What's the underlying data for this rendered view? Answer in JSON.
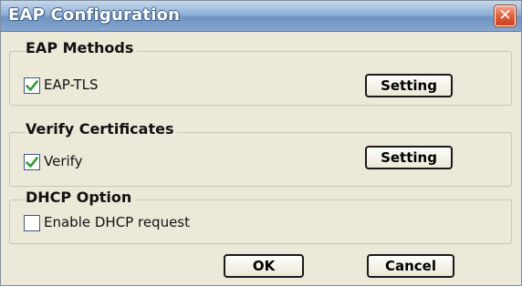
{
  "window": {
    "title": "EAP Configuration",
    "close_glyph": "✕"
  },
  "eap_methods": {
    "title": "EAP Methods",
    "checkbox_label": "EAP-TLS",
    "checked": true,
    "setting_label": "Setting"
  },
  "verify_certificates": {
    "title": "Verify Certificates",
    "checkbox_label": "Verify",
    "checked": true,
    "setting_label": "Setting"
  },
  "dhcp_option": {
    "title": "DHCP Option",
    "checkbox_label": "Enable DHCP request",
    "checked": false
  },
  "footer": {
    "ok_label": "OK",
    "cancel_label": "Cancel"
  },
  "colors": {
    "check_green": "#2e9a2e",
    "dialog_bg": "#ece9d8"
  },
  "icons": {
    "close": "close-icon",
    "check": "checkmark-icon"
  }
}
